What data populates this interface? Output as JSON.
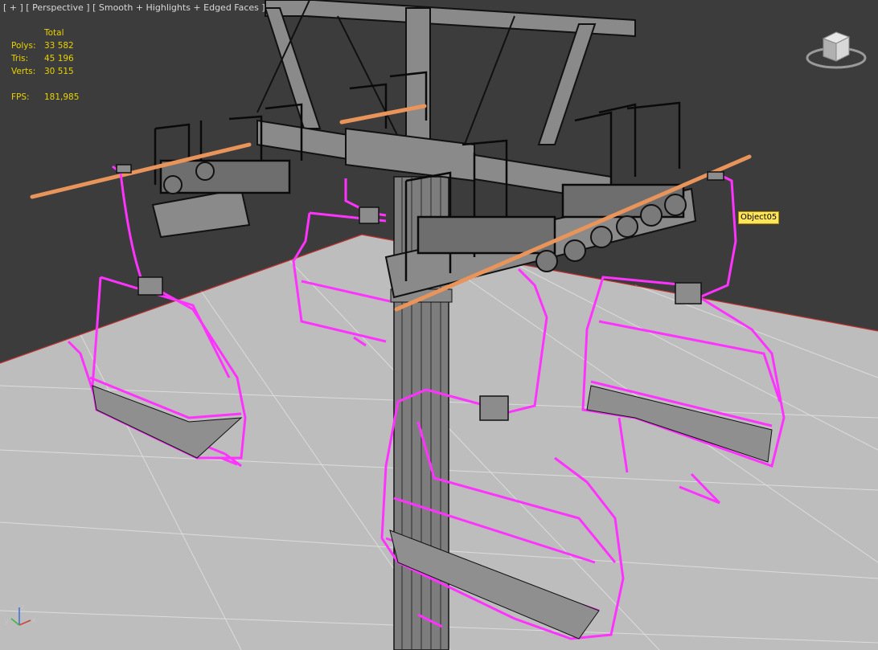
{
  "viewport": {
    "menu_plus": "[ + ]",
    "view_mode": "[ Perspective ]",
    "shading_mode": "[ Smooth + Highlights + Edged Faces ]"
  },
  "stats": {
    "header": "Total",
    "polys_label": "Polys:",
    "polys_value": "33 582",
    "tris_label": "Tris:",
    "tris_value": "45 196",
    "verts_label": "Verts:",
    "verts_value": "30 515",
    "fps_label": "FPS:",
    "fps_value": "181,985"
  },
  "object_label": "Object05",
  "axis": {
    "x": "x",
    "y": "y",
    "z": "z"
  },
  "colors": {
    "background": "#3c3c3c",
    "ground": "#bdbdbd",
    "grid_line": "#e0e0e0",
    "grid_axis": "#c03030",
    "model_wire": "#0a0a0a",
    "model_fill": "#7c7c7c",
    "selection": "#ff33ff",
    "rope": "#e8945a",
    "stats_text": "#e8d200",
    "label_bg": "#ffe55a"
  },
  "icons": {
    "viewcube": "viewcube-icon",
    "axis": "axis-tripod-icon"
  }
}
